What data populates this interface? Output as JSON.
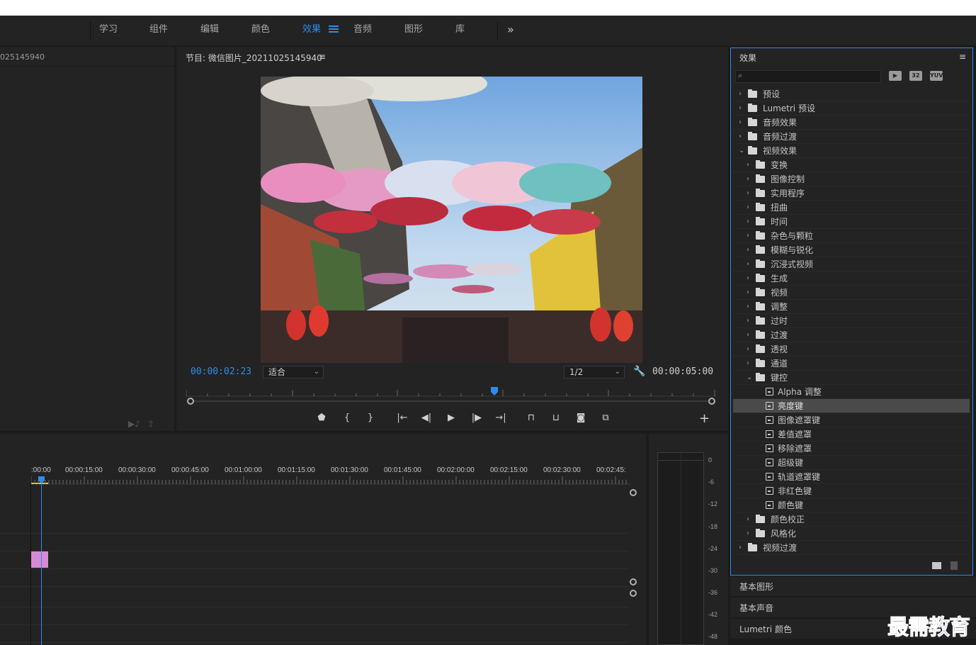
{
  "workspaces": {
    "items": [
      "学习",
      "组件",
      "编辑",
      "颜色",
      "效果",
      "音频",
      "图形",
      "库"
    ],
    "active_index": 4,
    "more": "»"
  },
  "source_panel": {
    "name": "025145940"
  },
  "program": {
    "title": "节目: 微信图片_20211025145940",
    "menu": "≡",
    "timecode_current": "00:00:02:23",
    "timecode_duration": "00:00:05:00",
    "fit": "适合",
    "resolution": "1/2"
  },
  "timeline": {
    "ruler_labels": [
      ":00:00",
      "00:00:15:00",
      "00:00:30:00",
      "00:00:45:00",
      "00:01:00:00",
      "00:01:15:00",
      "00:01:30:00",
      "00:01:45:00",
      "00:02:00:00",
      "00:02:15:00",
      "00:02:30:00",
      "00:02:45:"
    ]
  },
  "meter": {
    "labels": [
      "0",
      "-6",
      "-12",
      "-18",
      "-24",
      "-30",
      "-36",
      "-42",
      "-48"
    ]
  },
  "effects": {
    "title": "效果",
    "menu": "≡",
    "badges": [
      "32",
      "YUV"
    ],
    "tree": [
      {
        "label": "预设",
        "level": 0,
        "icon": "preset-folder",
        "expanded": false
      },
      {
        "label": "Lumetri 预设",
        "level": 0,
        "icon": "preset-folder",
        "expanded": false
      },
      {
        "label": "音频效果",
        "level": 0,
        "icon": "folder",
        "expanded": false
      },
      {
        "label": "音频过渡",
        "level": 0,
        "icon": "folder",
        "expanded": false
      },
      {
        "label": "视频效果",
        "level": 0,
        "icon": "folder",
        "expanded": true
      },
      {
        "label": "变换",
        "level": 1,
        "icon": "folder",
        "expanded": false
      },
      {
        "label": "图像控制",
        "level": 1,
        "icon": "folder",
        "expanded": false
      },
      {
        "label": "实用程序",
        "level": 1,
        "icon": "folder",
        "expanded": false
      },
      {
        "label": "扭曲",
        "level": 1,
        "icon": "folder",
        "expanded": false
      },
      {
        "label": "时间",
        "level": 1,
        "icon": "folder",
        "expanded": false
      },
      {
        "label": "杂色与颗粒",
        "level": 1,
        "icon": "folder",
        "expanded": false
      },
      {
        "label": "模糊与锐化",
        "level": 1,
        "icon": "folder",
        "expanded": false
      },
      {
        "label": "沉浸式视频",
        "level": 1,
        "icon": "folder",
        "expanded": false
      },
      {
        "label": "生成",
        "level": 1,
        "icon": "folder",
        "expanded": false
      },
      {
        "label": "视频",
        "level": 1,
        "icon": "folder",
        "expanded": false
      },
      {
        "label": "调整",
        "level": 1,
        "icon": "folder",
        "expanded": false
      },
      {
        "label": "过时",
        "level": 1,
        "icon": "folder",
        "expanded": false
      },
      {
        "label": "过渡",
        "level": 1,
        "icon": "folder",
        "expanded": false
      },
      {
        "label": "透视",
        "level": 1,
        "icon": "folder",
        "expanded": false
      },
      {
        "label": "通道",
        "level": 1,
        "icon": "folder",
        "expanded": false
      },
      {
        "label": "键控",
        "level": 1,
        "icon": "folder",
        "expanded": true
      },
      {
        "label": "Alpha 调整",
        "level": 2,
        "icon": "effect",
        "expanded": false
      },
      {
        "label": "亮度键",
        "level": 2,
        "icon": "effect",
        "expanded": false,
        "selected": true
      },
      {
        "label": "图像遮罩键",
        "level": 2,
        "icon": "effect",
        "expanded": false
      },
      {
        "label": "差值遮罩",
        "level": 2,
        "icon": "effect",
        "expanded": false
      },
      {
        "label": "移除遮罩",
        "level": 2,
        "icon": "effect",
        "expanded": false
      },
      {
        "label": "超级键",
        "level": 2,
        "icon": "effect",
        "expanded": false
      },
      {
        "label": "轨道遮罩键",
        "level": 2,
        "icon": "effect",
        "expanded": false
      },
      {
        "label": "非红色键",
        "level": 2,
        "icon": "effect",
        "expanded": false
      },
      {
        "label": "颜色键",
        "level": 2,
        "icon": "effect",
        "expanded": false
      },
      {
        "label": "颜色校正",
        "level": 1,
        "icon": "folder",
        "expanded": false
      },
      {
        "label": "风格化",
        "level": 1,
        "icon": "folder",
        "expanded": false
      },
      {
        "label": "视频过渡",
        "level": 0,
        "icon": "folder",
        "expanded": false
      }
    ]
  },
  "stacked_panels": [
    "基本图形",
    "基本声音",
    "Lumetri 颜色"
  ],
  "watermark": "最需教育",
  "colors": {
    "accent": "#2d8ceb",
    "clip": "#d68ad6"
  }
}
